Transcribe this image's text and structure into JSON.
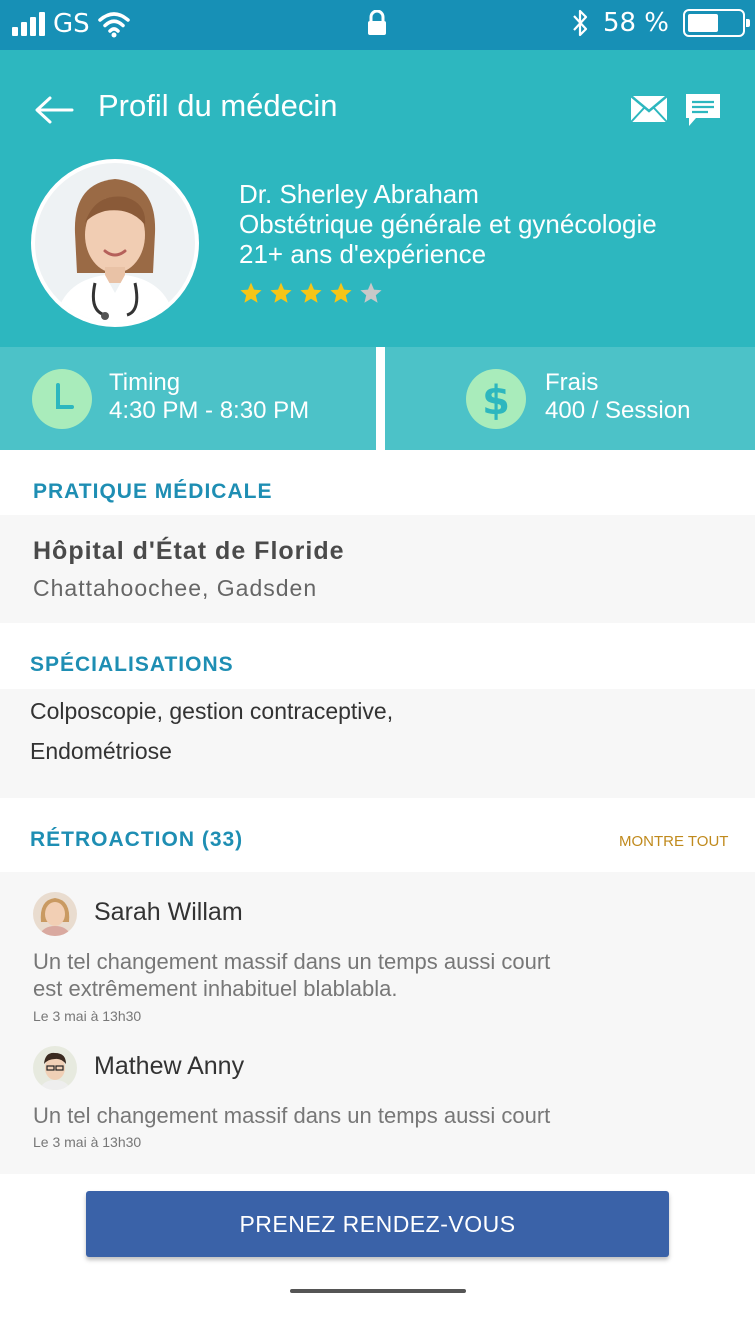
{
  "status_bar": {
    "carrier": "GS",
    "battery_pct": "58 %",
    "battery_level": 0.58,
    "icons": [
      "signal-icon",
      "wifi-icon",
      "lock-icon",
      "bluetooth-icon",
      "battery-icon"
    ]
  },
  "header": {
    "title": "Profil du médecin",
    "icons": [
      "back-arrow-icon",
      "mail-icon",
      "chat-icon"
    ]
  },
  "doctor": {
    "name": "Dr. Sherley Abraham",
    "specialty": "Obstétrique générale et gynécologie",
    "experience": "21+ ans d'expérience",
    "rating": 4,
    "rating_max": 5
  },
  "tiles": {
    "timing": {
      "label": "Timing",
      "value": "4:30 PM - 8:30 PM",
      "icon": "clock-icon"
    },
    "fees": {
      "label": "Frais",
      "value": "400 / Session",
      "icon": "dollar-icon"
    }
  },
  "practice": {
    "heading": "PRATIQUE MÉDICALE",
    "hospital": "Hôpital d'État de Floride",
    "location": "Chattahoochee, Gadsden"
  },
  "specializations": {
    "heading": "SPÉCIALISATIONS",
    "line1": "Colposcopie, gestion contraceptive,",
    "line2": "Endométriose"
  },
  "feedback": {
    "heading": "RÉTROACTION (33)",
    "show_all": "MONTRE TOUT",
    "reviews": [
      {
        "name": "Sarah Willam",
        "text1": "Un tel changement massif dans un temps aussi court",
        "text2": "est extrêmement inhabituel blablabla.",
        "date": "Le 3 mai à 13h30"
      },
      {
        "name": "Mathew Anny",
        "text1": "Un tel changement massif dans un temps aussi court",
        "text2": "",
        "date": "Le 3 mai à 13h30"
      }
    ]
  },
  "cta": {
    "label": "PRENEZ RENDEZ-VOUS"
  },
  "colors": {
    "status_bar": "#1790b6",
    "header": "#2db7bf",
    "tile": "#4cc2c8",
    "tile_icon": "#a9ecbb",
    "section_title": "#1e8eb3",
    "show_all": "#c08a1d",
    "cta": "#3a62a8",
    "star_on": "#f5c518",
    "star_off": "#c8c8c8"
  }
}
